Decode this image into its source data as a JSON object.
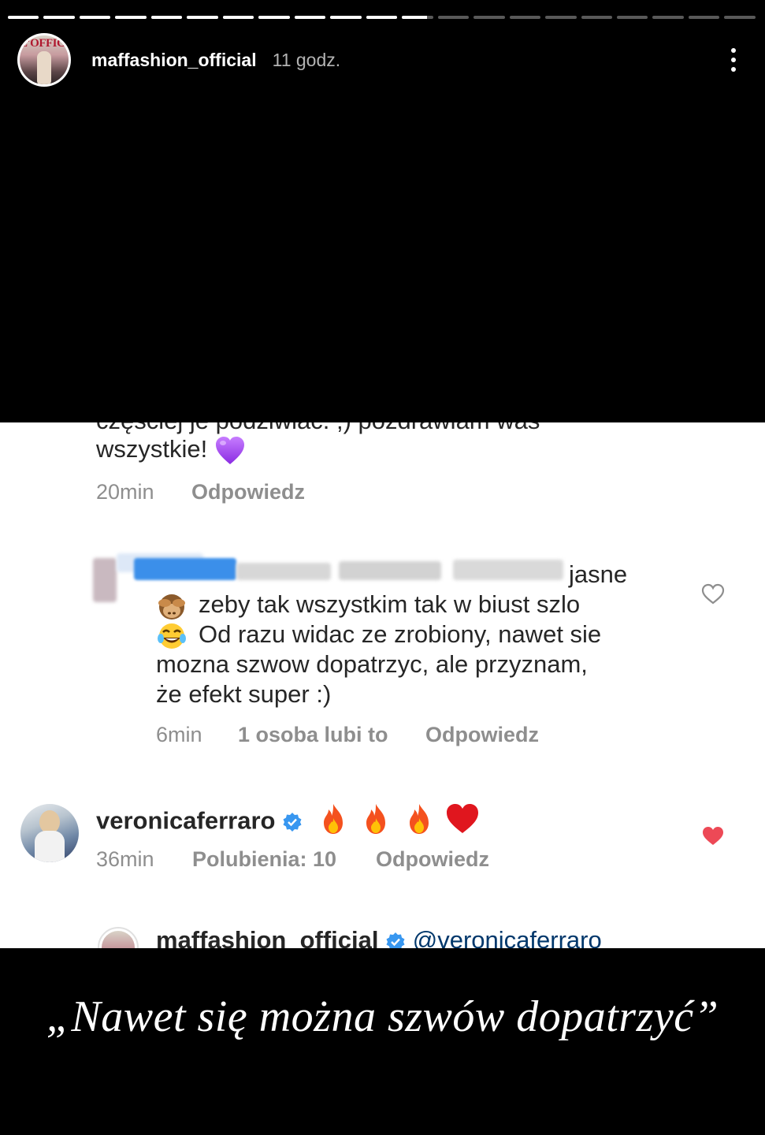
{
  "story": {
    "progress": {
      "segments_total": 21,
      "segments_complete": 11,
      "current_segment_fraction": 0.8
    },
    "header": {
      "username": "maffashion_official",
      "timestamp": "11 godz.",
      "avatar_text": "L'OFFICIEL",
      "more_icon": "more-vertical-icon"
    },
    "screenshot": {
      "cut_top_line": "częściej je podziwiać. ;) pozdrawiam was",
      "comment1": {
        "text": "wszystkie!",
        "emoji": "purple-heart",
        "time": "20min",
        "reply": "Odpowiedz"
      },
      "comment2": {
        "line1": "jasne",
        "line2": "zeby tak wszystkim tak w biust szlo",
        "line3": "Od razu widac ze zrobiony,  nawet sie",
        "line4": "mozna szwow dopatrzyc, ale przyznam,",
        "line5": "że efekt super :)",
        "emoji1": "see-no-evil-monkey",
        "emoji2": "face-with-tears-of-joy",
        "time": "6min",
        "likes": "1 osoba lubi to",
        "reply": "Odpowiedz"
      },
      "comment3": {
        "username": "veronicaferraro",
        "emojis": "fire fire fire red-heart",
        "time": "36min",
        "likes": "Polubienia: 10",
        "reply": "Odpowiedz",
        "liked": true
      },
      "comment4": {
        "username": "maffashion_official",
        "mention": "@veronicaferraro"
      }
    },
    "caption": "„Nawet się można szwów dopatrzyć”",
    "colors": {
      "background": "#000000",
      "panel": "#ffffff",
      "text": "#262626",
      "muted": "#8e8e8e",
      "link": "#00376b",
      "like_red": "#ed4956",
      "verified_blue": "#3897f0",
      "blur_blue": "#3b8fea"
    }
  }
}
